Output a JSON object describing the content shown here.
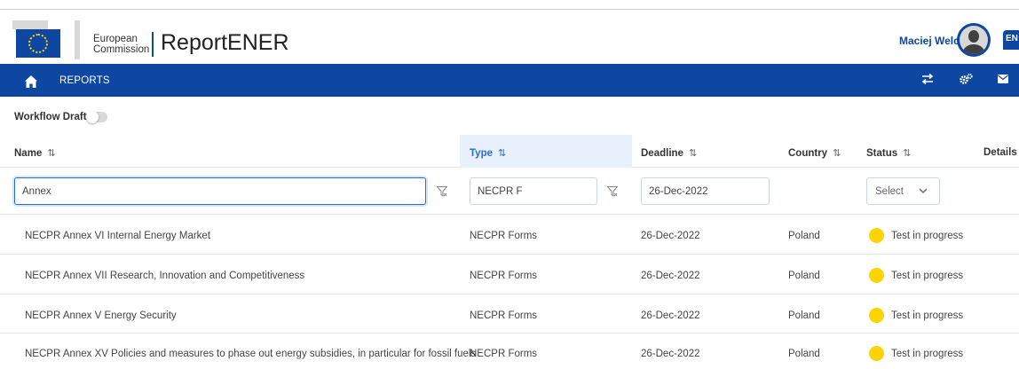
{
  "header": {
    "org_line1": "European",
    "org_line2": "Commission",
    "app_title": "ReportENER",
    "user_name": "Maciej Welc",
    "language": "EN"
  },
  "nav": {
    "reports_label": "REPORTS",
    "icons": [
      "transfer-icon",
      "settings-gears-icon",
      "mail-icon"
    ]
  },
  "workflow": {
    "label": "Workflow Draft",
    "enabled": false
  },
  "table": {
    "columns": [
      {
        "label": "Name",
        "sort": "⇅"
      },
      {
        "label": "Type",
        "sort": "⇅"
      },
      {
        "label": "Deadline",
        "sort": "⇅"
      },
      {
        "label": "Country",
        "sort": "⇅"
      },
      {
        "label": "Status",
        "sort": "⇅"
      },
      {
        "label": "Details"
      }
    ],
    "filters": {
      "name": "Annex",
      "type": "NECPR F",
      "deadline": "26-Dec-2022",
      "status_placeholder": "Select"
    },
    "rows": [
      {
        "name": "NECPR Annex VI Internal Energy Market",
        "type": "NECPR Forms",
        "deadline": "26-Dec-2022",
        "country": "Poland",
        "status": "Test in progress"
      },
      {
        "name": "NECPR Annex VII Research, Innovation and Competitiveness",
        "type": "NECPR Forms",
        "deadline": "26-Dec-2022",
        "country": "Poland",
        "status": "Test in progress"
      },
      {
        "name": "NECPR Annex V Energy Security",
        "type": "NECPR Forms",
        "deadline": "26-Dec-2022",
        "country": "Poland",
        "status": "Test in progress"
      },
      {
        "name": "NECPR Annex XV Policies and measures to phase out energy subsidies, in particular for fossil fuels",
        "type": "NECPR Forms",
        "deadline": "26-Dec-2022",
        "country": "Poland",
        "status": "Test in progress"
      }
    ]
  },
  "colors": {
    "brand": "#0e47a1",
    "accent": "#2b6bd6",
    "status_in_progress": "#fdd300"
  }
}
